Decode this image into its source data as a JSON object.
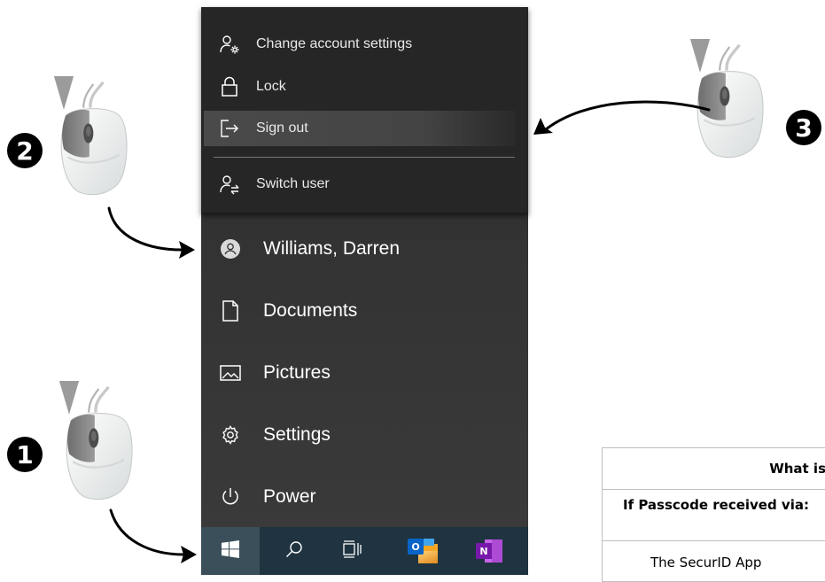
{
  "account_menu": {
    "items": [
      {
        "label": "Change account settings",
        "icon": "account-settings-icon"
      },
      {
        "label": "Lock",
        "icon": "lock-icon"
      },
      {
        "label": "Sign out",
        "icon": "sign-out-icon",
        "highlighted": true
      },
      {
        "label": "Switch user",
        "icon": "switch-user-icon"
      }
    ]
  },
  "start_menu": {
    "items": [
      {
        "label": "Williams, Darren",
        "icon": "user-avatar-icon"
      },
      {
        "label": "Documents",
        "icon": "document-icon"
      },
      {
        "label": "Pictures",
        "icon": "pictures-icon"
      },
      {
        "label": "Settings",
        "icon": "gear-icon"
      },
      {
        "label": "Power",
        "icon": "power-icon"
      }
    ]
  },
  "taskbar": {
    "icons": [
      "windows-start-icon",
      "search-icon",
      "task-view-icon",
      "outlook-icon",
      "onenote-icon"
    ],
    "outlook_letter": "O",
    "onenote_letter": "N"
  },
  "steps": [
    {
      "number": "1"
    },
    {
      "number": "2"
    },
    {
      "number": "3"
    }
  ],
  "table": {
    "header": "What is",
    "col1_header": "If Passcode received via:",
    "row1_col1": "The SecurID App"
  },
  "colors": {
    "menu_bg": "#2f2f2f",
    "flyout_bg": "#262626",
    "taskbar_bg": "#1f3440",
    "outlook_blue": "#0a64c8",
    "onenote_purple": "#7719aa"
  }
}
